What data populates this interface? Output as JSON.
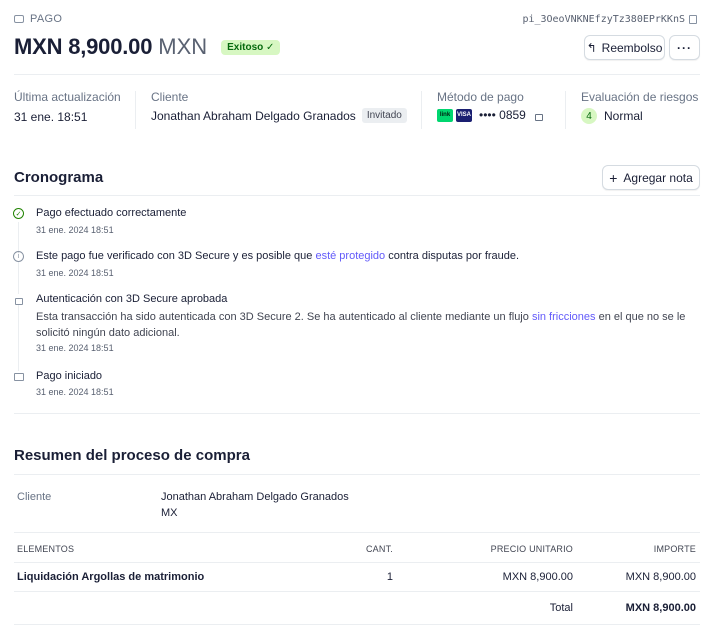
{
  "header": {
    "eyebrow": "PAGO",
    "payment_id": "pi_3OeoVNKNEfzyTz380EPrKKnS",
    "amount": "MXN 8,900.00",
    "currency": "MXN",
    "status_badge": "Exitoso ✓",
    "refund_label": "Reembolso",
    "more_label": "···"
  },
  "summary": {
    "last_update_label": "Última actualización",
    "last_update_value": "31 ene. 18:51",
    "customer_label": "Cliente",
    "customer_name": "Jonathan Abraham Delgado Granados",
    "customer_chip": "Invitado",
    "payment_method_label": "Método de pago",
    "card_brand_link": "link",
    "card_brand_visa": "VISA",
    "card_last4": "•••• 0859",
    "risk_label": "Evaluación de riesgos",
    "risk_score": "4",
    "risk_level": "Normal"
  },
  "timeline": {
    "title": "Cronograma",
    "add_note_label": "Agregar nota",
    "events": [
      {
        "icon": "check-circle-icon",
        "title": "Pago efectuado correctamente",
        "date": "31 ene. 2024 18:51"
      },
      {
        "icon": "info-icon",
        "title_pre": "Este pago fue verificado con 3D Secure y es posible que ",
        "title_link": "esté protegido",
        "title_post": " contra disputas por fraude.",
        "date": "31 ene. 2024 18:51"
      },
      {
        "icon": "lock-icon",
        "title": "Autenticación con 3D Secure aprobada",
        "desc_pre": "Esta transacción ha sido autenticada con 3D Secure 2. Se ha autenticado al cliente mediante un flujo ",
        "desc_link": "sin fricciones",
        "desc_post": " en el que no se le solicitó ningún dato adicional.",
        "date": "31 ene. 2024 18:51"
      },
      {
        "icon": "card-icon",
        "title": "Pago iniciado",
        "date": "31 ene. 2024 18:51"
      }
    ]
  },
  "checkout": {
    "title": "Resumen del proceso de compra",
    "customer_label": "Cliente",
    "customer_name": "Jonathan Abraham Delgado Granados",
    "customer_country": "MX",
    "columns": [
      "ELEMENTOS",
      "CANT.",
      "PRECIO UNITARIO",
      "IMPORTE"
    ],
    "items": [
      {
        "name": "Liquidación Argollas de matrimonio",
        "qty": "1",
        "unit_price": "MXN 8,900.00",
        "amount": "MXN 8,900.00"
      }
    ],
    "total_label": "Total",
    "total_value": "MXN 8,900.00"
  },
  "colors": {
    "accent": "#625afa",
    "success_bg": "#d7f7c2",
    "success_fg": "#05690d"
  }
}
